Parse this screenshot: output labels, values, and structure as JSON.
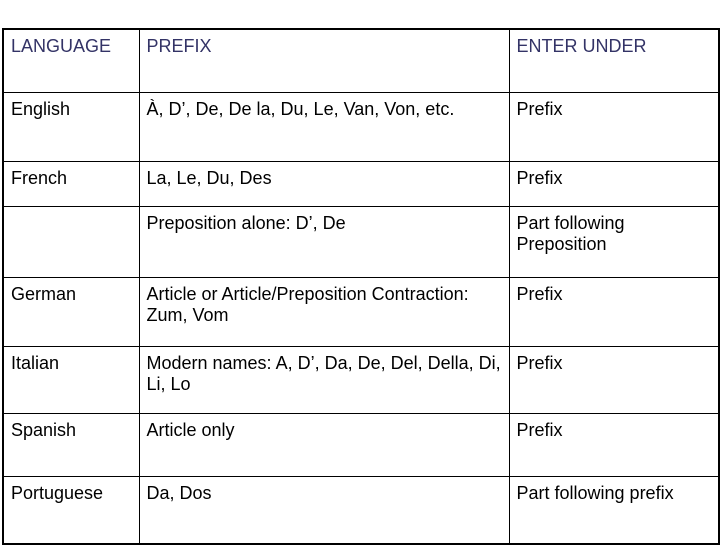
{
  "table": {
    "name": "language-prefix-filing-table",
    "columns": [
      {
        "key": "language",
        "label": "LANGUAGE"
      },
      {
        "key": "prefix",
        "label": "PREFIX"
      },
      {
        "key": "enter",
        "label": "ENTER UNDER"
      }
    ],
    "header_text_color": "#333366",
    "body_text_color": "#000000",
    "border_color": "#000000",
    "background_color": "#ffffff",
    "rows": [
      {
        "language": "English",
        "prefix": "À, D’, De, De la, Du, Le, Van, Von, etc.",
        "enter": "Prefix"
      },
      {
        "language": "French",
        "prefix": "La, Le, Du, Des",
        "enter": "Prefix"
      },
      {
        "language": "",
        "prefix": "Preposition alone: D’, De",
        "enter": "Part following Preposition"
      },
      {
        "language": "German",
        "prefix": "Article or Article/Preposition Contraction: Zum, Vom",
        "enter": "Prefix"
      },
      {
        "language": "Italian",
        "prefix": "Modern names: A, D’, Da, De, Del, Della, Di, Li, Lo",
        "enter": "Prefix"
      },
      {
        "language": "Spanish",
        "prefix": "Article only",
        "enter": "Prefix"
      },
      {
        "language": "Portuguese",
        "prefix": "Da, Dos",
        "enter": "Part following prefix"
      }
    ]
  }
}
